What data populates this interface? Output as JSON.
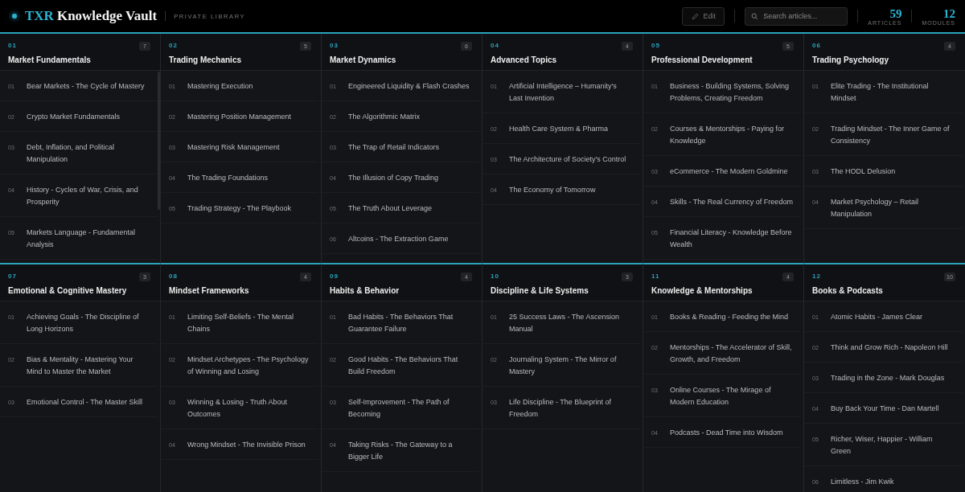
{
  "header": {
    "brand_accent": "TXR",
    "brand_title": "Knowledge Vault",
    "subtitle": "PRIVATE LIBRARY",
    "edit_button": "Edit",
    "search": {
      "placeholder": "Search articles..."
    },
    "stats": [
      {
        "value": "59",
        "label": "ARTICLES"
      },
      {
        "value": "12",
        "label": "MODULES"
      }
    ]
  },
  "modules": [
    {
      "number": "01",
      "title": "Market Fundamentals",
      "count": "7",
      "scrollbar": true,
      "articles": [
        {
          "number": "01",
          "title": "Bear Markets - The Cycle of Mastery"
        },
        {
          "number": "02",
          "title": "Crypto Market Fundamentals"
        },
        {
          "number": "03",
          "title": "Debt, Inflation, and Political Manipulation"
        },
        {
          "number": "04",
          "title": "History - Cycles of War, Crisis, and Prosperity"
        },
        {
          "number": "05",
          "title": "Markets Language - Fundamental Analysis"
        }
      ]
    },
    {
      "number": "02",
      "title": "Trading Mechanics",
      "count": "5",
      "scrollbar": false,
      "articles": [
        {
          "number": "01",
          "title": "Mastering Execution"
        },
        {
          "number": "02",
          "title": "Mastering Position Management"
        },
        {
          "number": "03",
          "title": "Mastering Risk Management"
        },
        {
          "number": "04",
          "title": "The Trading Foundations"
        },
        {
          "number": "05",
          "title": "Trading Strategy - The Playbook"
        }
      ]
    },
    {
      "number": "03",
      "title": "Market Dynamics",
      "count": "6",
      "scrollbar": false,
      "articles": [
        {
          "number": "01",
          "title": "Engineered Liquidity & Flash Crashes"
        },
        {
          "number": "02",
          "title": "The Algorithmic Matrix"
        },
        {
          "number": "03",
          "title": "The Trap of Retail Indicators"
        },
        {
          "number": "04",
          "title": "The Illusion of Copy Trading"
        },
        {
          "number": "05",
          "title": "The Truth About Leverage"
        },
        {
          "number": "06",
          "title": "Altcoins - The Extraction Game"
        }
      ]
    },
    {
      "number": "04",
      "title": "Advanced Topics",
      "count": "4",
      "scrollbar": false,
      "articles": [
        {
          "number": "01",
          "title": "Artificial Intelligence – Humanity's Last Invention"
        },
        {
          "number": "02",
          "title": "Health Care System & Pharma"
        },
        {
          "number": "03",
          "title": "The Architecture of Society's Control"
        },
        {
          "number": "04",
          "title": "The Economy of Tomorrow"
        }
      ]
    },
    {
      "number": "05",
      "title": "Professional Development",
      "count": "5",
      "scrollbar": false,
      "articles": [
        {
          "number": "01",
          "title": "Business - Building Systems, Solving Problems, Creating Freedom"
        },
        {
          "number": "02",
          "title": "Courses & Mentorships - Paying for Knowledge"
        },
        {
          "number": "03",
          "title": "eCommerce - The Modern Goldmine"
        },
        {
          "number": "04",
          "title": "Skills - The Real Currency of Freedom"
        },
        {
          "number": "05",
          "title": "Financial Literacy - Knowledge Before Wealth"
        }
      ]
    },
    {
      "number": "06",
      "title": "Trading Psychology",
      "count": "4",
      "scrollbar": false,
      "articles": [
        {
          "number": "01",
          "title": "Elite Trading - The Institutional Mindset"
        },
        {
          "number": "02",
          "title": "Trading Mindset - The Inner Game of Consistency"
        },
        {
          "number": "03",
          "title": "The HODL Delusion"
        },
        {
          "number": "04",
          "title": "Market Psychology – Retail Manipulation"
        }
      ]
    },
    {
      "number": "07",
      "title": "Emotional & Cognitive Mastery",
      "count": "3",
      "scrollbar": false,
      "articles": [
        {
          "number": "01",
          "title": "Achieving Goals - The Discipline of Long Horizons"
        },
        {
          "number": "02",
          "title": "Bias & Mentality - Mastering Your Mind to Master the Market"
        },
        {
          "number": "03",
          "title": "Emotional Control - The Master Skill"
        }
      ]
    },
    {
      "number": "08",
      "title": "Mindset Frameworks",
      "count": "4",
      "scrollbar": false,
      "articles": [
        {
          "number": "01",
          "title": "Limiting Self-Beliefs - The Mental Chains"
        },
        {
          "number": "02",
          "title": "Mindset Archetypes - The Psychology of Winning and Losing"
        },
        {
          "number": "03",
          "title": "Winning & Losing - Truth About Outcomes"
        },
        {
          "number": "04",
          "title": "Wrong Mindset - The Invisible Prison"
        }
      ]
    },
    {
      "number": "09",
      "title": "Habits & Behavior",
      "count": "4",
      "scrollbar": false,
      "articles": [
        {
          "number": "01",
          "title": "Bad Habits - The Behaviors That Guarantee Failure"
        },
        {
          "number": "02",
          "title": "Good Habits - The Behaviors That Build Freedom"
        },
        {
          "number": "03",
          "title": "Self-Improvement - The Path of Becoming"
        },
        {
          "number": "04",
          "title": "Taking Risks - The Gateway to a Bigger Life"
        }
      ]
    },
    {
      "number": "10",
      "title": "Discipline & Life Systems",
      "count": "3",
      "scrollbar": false,
      "articles": [
        {
          "number": "01",
          "title": "25 Success Laws - The Ascension Manual"
        },
        {
          "number": "02",
          "title": "Journaling System - The Mirror of Mastery"
        },
        {
          "number": "03",
          "title": "Life Discipline - The Blueprint of Freedom"
        }
      ]
    },
    {
      "number": "11",
      "title": "Knowledge & Mentorships",
      "count": "4",
      "scrollbar": false,
      "articles": [
        {
          "number": "01",
          "title": "Books & Reading - Feeding the Mind"
        },
        {
          "number": "02",
          "title": "Mentorships - The Accelerator of Skill, Growth, and Freedom"
        },
        {
          "number": "03",
          "title": "Online Courses - The Mirage of Modern Education"
        },
        {
          "number": "04",
          "title": "Podcasts - Dead Time into Wisdom"
        }
      ]
    },
    {
      "number": "12",
      "title": "Books & Podcasts",
      "count": "10",
      "scrollbar": false,
      "articles": [
        {
          "number": "01",
          "title": "Atomic Habits - James Clear"
        },
        {
          "number": "02",
          "title": "Think and Grow Rich - Napoleon Hill"
        },
        {
          "number": "03",
          "title": "Trading in the Zone - Mark Douglas"
        },
        {
          "number": "04",
          "title": "Buy Back Your Time - Dan Martell"
        },
        {
          "number": "05",
          "title": "Richer, Wiser, Happier - William Green"
        },
        {
          "number": "06",
          "title": "Limitless - Jim Kwik"
        }
      ]
    }
  ]
}
